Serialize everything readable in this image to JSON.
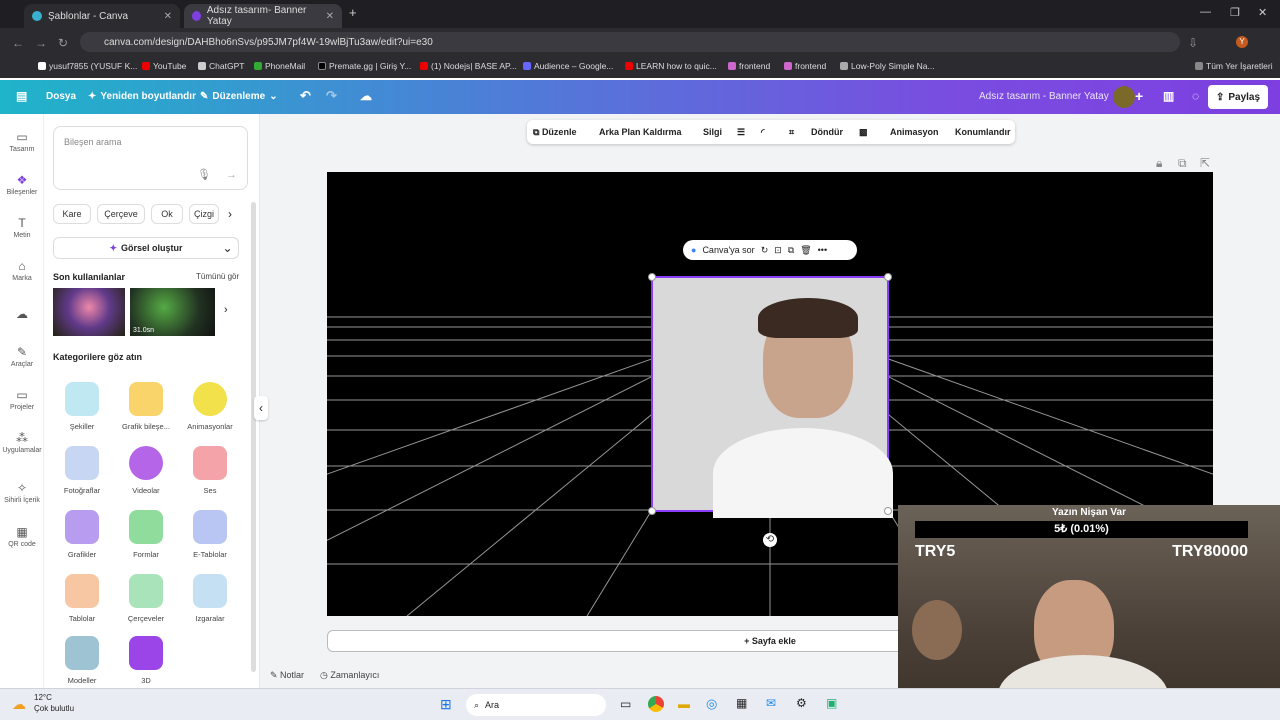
{
  "browser": {
    "tabs": [
      {
        "title": "Şablonlar - Canva"
      },
      {
        "title": "Adsız tasarım- Banner Yatay"
      }
    ],
    "url": "canva.com/design/DAHBho6nSvs/p95JM7pf4W-19wlBjTu3aw/edit?ui=e30",
    "bookmarks": [
      "yusuf7855 (YUSUF K...",
      "YouTube",
      "ChatGPT",
      "PhoneMail",
      "Premate.gg | Giriş Y...",
      "(1) Nodejs| BASE AP...",
      "Audience – Google...",
      "LEARN how to quic...",
      "frontend",
      "frontend",
      "Low-Poly Simple Na..."
    ],
    "all_bookmarks": "Tüm Yer İşaretleri"
  },
  "header": {
    "file": "Dosya",
    "resize": "Yeniden boyutlandır",
    "edit": "Düzenleme",
    "title": "Adsız tasarım - Banner Yatay",
    "share": "Paylaş"
  },
  "rail": [
    "Tasarım",
    "Bileşenler",
    "Metin",
    "Marka",
    "",
    "Araçlar",
    "Projeler",
    "Uygulamalar",
    "Sihirli İçerik",
    "QR code"
  ],
  "panel": {
    "search_placeholder": "Bileşen arama",
    "chips": [
      "Kare",
      "Çerçeve",
      "Ok",
      "Çizgi"
    ],
    "generate": "Görsel oluştur",
    "recent": "Son kullanılanlar",
    "see_all": "Tümünü gör",
    "video_duration": "31.0sn",
    "categories_title": "Kategorilere göz atın",
    "categories": [
      "Şekiller",
      "Grafik bileşe...",
      "Animasyonlar",
      "Fotoğraflar",
      "Videolar",
      "Ses",
      "Grafikler",
      "Formlar",
      "E-Tablolar",
      "Tablolar",
      "Çerçeveler",
      "Izgaralar",
      "Modeller",
      "3D"
    ]
  },
  "toolbar": {
    "edit": "Düzenle",
    "bg_remove": "Arka Plan Kaldırma",
    "eraser": "Silgi",
    "rotate": "Döndür",
    "animation": "Animasyon",
    "position": "Konumlandır"
  },
  "canvas": {
    "ask": "Canva'ya sor",
    "add_page": "+ Sayfa ekle",
    "notes": "Notlar",
    "timer": "Zamanlayıcı"
  },
  "taskbar": {
    "weather_temp": "12°C",
    "weather_desc": "Çok bulutlu",
    "search": "Ara"
  },
  "overlay": {
    "title": "Yazın Nişan Var",
    "progress": "5₺ (0.01%)",
    "min": "TRY5",
    "max": "TRY80000"
  }
}
